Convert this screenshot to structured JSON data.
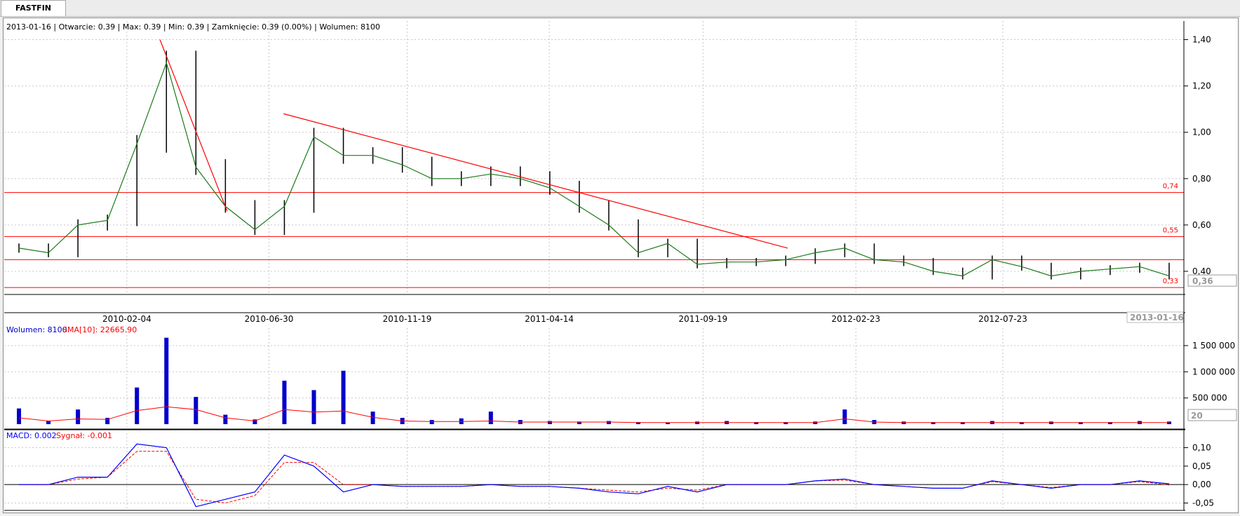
{
  "window": {
    "tab_label": "FASTFIN"
  },
  "price_panel": {
    "info_text": "2013-01-16 | Otwarcie: 0.39 | Max: 0.39 | Min: 0.39 | Zamknięcie: 0.39 (0.00%)  | Wolumen: 8100",
    "y_ticks": [
      "1,40",
      "1,20",
      "1,00",
      "0,80",
      "0,60",
      "0,40"
    ],
    "last_price_label": "0,36",
    "last_date_label": "2013-01-16",
    "x_ticks": [
      "2010-02-04",
      "2010-06-30",
      "2010-11-19",
      "2011-04-14",
      "2011-09-19",
      "2012-02-23",
      "2012-07-23"
    ],
    "hlines": [
      {
        "value": 0.74,
        "label": "0,74"
      },
      {
        "value": 0.55,
        "label": "0,55"
      },
      {
        "value": 0.45,
        "label": ""
      },
      {
        "value": 0.33,
        "label": "0,33"
      }
    ],
    "colors": {
      "candles": "#000000",
      "sma": "#1a7a1a",
      "lines": "#ff0000",
      "grid": "#c8c8c8"
    }
  },
  "volume_panel": {
    "label_volume": "Wolumen: 8100",
    "label_sma": "SMA[10]: 22665.90",
    "y_ticks": [
      "1 500 000",
      "1 000 000",
      "500 000"
    ],
    "period_box": "20",
    "colors": {
      "bars": "#0000cc",
      "sma": "#ff0000"
    }
  },
  "macd_panel": {
    "label_macd": "MACD: 0.002",
    "label_signal": "Sygnał: -0.001",
    "y_ticks": [
      "0,10",
      "0,05",
      "0,00",
      "-0,05"
    ],
    "colors": {
      "macd": "#0000ff",
      "signal": "#ff0000"
    }
  },
  "chart_data": [
    {
      "type": "line",
      "title": "FASTFIN",
      "ylim": [
        0.3,
        1.45
      ],
      "x": [
        "2009-10",
        "2009-11",
        "2009-12",
        "2010-01",
        "2010-02",
        "2010-03",
        "2010-04",
        "2010-05",
        "2010-06",
        "2010-07",
        "2010-08",
        "2010-09",
        "2010-10",
        "2010-11",
        "2010-12",
        "2011-01",
        "2011-02",
        "2011-03",
        "2011-04",
        "2011-05",
        "2011-06",
        "2011-07",
        "2011-08",
        "2011-09",
        "2011-10",
        "2011-11",
        "2011-12",
        "2012-01",
        "2012-02",
        "2012-03",
        "2012-04",
        "2012-05",
        "2012-06",
        "2012-07",
        "2012-08",
        "2012-09",
        "2012-10",
        "2012-11",
        "2012-12",
        "2013-01"
      ],
      "series": [
        {
          "values": [
            0.5,
            0.48,
            0.6,
            0.62,
            0.95,
            1.3,
            0.85,
            0.68,
            0.58,
            0.68,
            0.98,
            0.9,
            0.9,
            0.86,
            0.8,
            0.8,
            0.82,
            0.8,
            0.76,
            0.68,
            0.6,
            0.48,
            0.52,
            0.43,
            0.44,
            0.44,
            0.45,
            0.48,
            0.5,
            0.45,
            0.44,
            0.4,
            0.38,
            0.45,
            0.42,
            0.38,
            0.4,
            0.41,
            0.42,
            0.38
          ]
        }
      ],
      "trendlines": [
        {
          "from": [
            "2010-03-10",
            1.4
          ],
          "to": [
            "2010-05-18",
            0.66
          ]
        },
        {
          "from": [
            "2010-07-15",
            1.08
          ],
          "to": [
            "2011-12-15",
            0.5
          ]
        }
      ],
      "last_value": 0.36
    },
    {
      "type": "bar",
      "title": "Wolumen",
      "ylim": [
        0,
        1700000
      ],
      "categories": [
        "2009-10",
        "2009-11",
        "2009-12",
        "2010-01",
        "2010-02",
        "2010-03",
        "2010-04",
        "2010-05",
        "2010-06",
        "2010-07",
        "2010-08",
        "2010-09",
        "2010-10",
        "2010-11",
        "2010-12",
        "2011-01",
        "2011-02",
        "2011-03",
        "2011-04",
        "2011-05",
        "2011-06",
        "2011-07",
        "2011-08",
        "2011-09",
        "2011-10",
        "2011-11",
        "2011-12",
        "2012-01",
        "2012-02",
        "2012-03",
        "2012-04",
        "2012-05",
        "2012-06",
        "2012-07",
        "2012-08",
        "2012-09",
        "2012-10",
        "2012-11",
        "2012-12",
        "2013-01"
      ],
      "series": [
        {
          "name": "Wolumen",
          "values": [
            300000,
            60000,
            280000,
            120000,
            700000,
            1650000,
            520000,
            180000,
            90000,
            830000,
            650000,
            1020000,
            240000,
            120000,
            80000,
            110000,
            240000,
            80000,
            60000,
            50000,
            60000,
            40000,
            30000,
            50000,
            60000,
            40000,
            40000,
            50000,
            280000,
            80000,
            50000,
            40000,
            40000,
            60000,
            40000,
            50000,
            40000,
            40000,
            60000,
            50000
          ]
        },
        {
          "name": "SMA[10]",
          "values": [
            120000,
            60000,
            100000,
            90000,
            260000,
            330000,
            280000,
            120000,
            60000,
            280000,
            230000,
            250000,
            130000,
            60000,
            50000,
            50000,
            60000,
            40000,
            40000,
            40000,
            40000,
            30000,
            30000,
            30000,
            30000,
            30000,
            30000,
            30000,
            100000,
            40000,
            30000,
            30000,
            30000,
            30000,
            30000,
            30000,
            30000,
            30000,
            30000,
            30000
          ]
        }
      ]
    },
    {
      "type": "line",
      "title": "MACD",
      "ylim": [
        -0.07,
        0.12
      ],
      "x": [
        "2009-10",
        "2009-11",
        "2009-12",
        "2010-01",
        "2010-02",
        "2010-03",
        "2010-04",
        "2010-05",
        "2010-06",
        "2010-07",
        "2010-08",
        "2010-09",
        "2010-10",
        "2010-11",
        "2010-12",
        "2011-01",
        "2011-02",
        "2011-03",
        "2011-04",
        "2011-05",
        "2011-06",
        "2011-07",
        "2011-08",
        "2011-09",
        "2011-10",
        "2011-11",
        "2011-12",
        "2012-01",
        "2012-02",
        "2012-03",
        "2012-04",
        "2012-05",
        "2012-06",
        "2012-07",
        "2012-08",
        "2012-09",
        "2012-10",
        "2012-11",
        "2012-12",
        "2013-01"
      ],
      "series": [
        {
          "name": "MACD",
          "values": [
            0.0,
            0.0,
            0.02,
            0.02,
            0.11,
            0.1,
            -0.06,
            -0.04,
            -0.02,
            0.08,
            0.05,
            -0.02,
            0.0,
            -0.005,
            -0.005,
            -0.005,
            0.0,
            -0.005,
            -0.005,
            -0.01,
            -0.02,
            -0.025,
            -0.005,
            -0.02,
            0.0,
            0.0,
            0.0,
            0.01,
            0.015,
            0.0,
            -0.005,
            -0.01,
            -0.01,
            0.01,
            0.0,
            -0.01,
            0.0,
            0.0,
            0.01,
            0.002
          ]
        },
        {
          "name": "Sygnał",
          "values": [
            0.0,
            0.0,
            0.015,
            0.02,
            0.09,
            0.09,
            -0.04,
            -0.05,
            -0.03,
            0.06,
            0.06,
            0.0,
            0.0,
            -0.005,
            -0.005,
            -0.005,
            0.0,
            -0.005,
            -0.005,
            -0.01,
            -0.015,
            -0.02,
            -0.01,
            -0.015,
            0.0,
            0.0,
            0.0,
            0.01,
            0.012,
            0.0,
            -0.005,
            -0.01,
            -0.01,
            0.008,
            0.0,
            -0.008,
            0.0,
            0.0,
            0.008,
            -0.001
          ]
        }
      ]
    }
  ]
}
